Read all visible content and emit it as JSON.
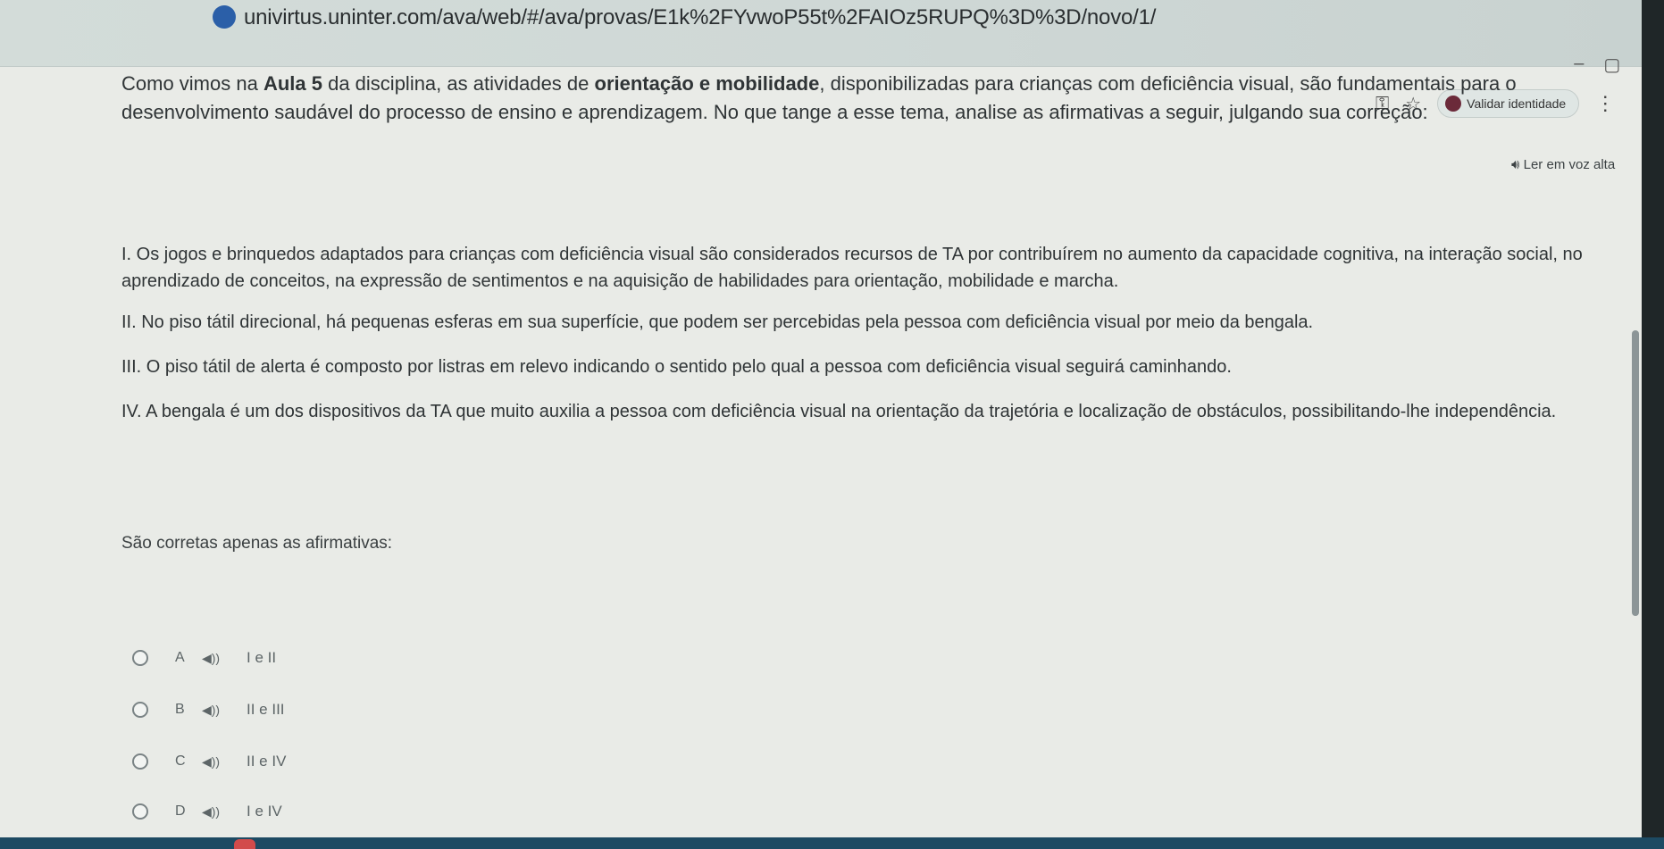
{
  "browser": {
    "url": "univirtus.uninter.com/ava/web/#/ava/provas/E1k%2FYvwoP55t%2FAIOz5RUPQ%3D%3D/novo/1/",
    "identity_button": "Validar identidade"
  },
  "page": {
    "read_aloud": "Ler em voz alta",
    "intro_part1": "Como vimos na ",
    "intro_bold1": "Aula 5",
    "intro_part2": " da disciplina, as atividades de ",
    "intro_bold2": "orientação e mobilidade",
    "intro_part3": ", disponibilizadas para crianças com deficiência visual, são fundamentais para o desenvolvimento saudável do processo de ensino e aprendizagem. No que tange a esse tema, analise as afirmativas a seguir, julgando sua correção:",
    "statements": [
      "I. Os jogos e brinquedos adaptados para crianças com deficiência visual são considerados recursos de TA por contribuírem no aumento da capacidade cognitiva, na interação social, no aprendizado de conceitos, na expressão de sentimentos e na aquisição de habilidades para orientação, mobilidade e marcha.",
      "II. No piso tátil direcional, há pequenas esferas em sua superfície, que podem ser percebidas pela pessoa com deficiência visual por meio da bengala.",
      "III. O piso tátil de alerta é composto por listras em relevo indicando o sentido pelo qual a pessoa com deficiência visual seguirá caminhando.",
      "IV. A bengala é um dos dispositivos da TA que muito auxilia a pessoa com deficiência visual na orientação da trajetória e localização de obstáculos, possibilitando-lhe independência."
    ],
    "prompt": "São corretas apenas as afirmativas:",
    "options": [
      {
        "letter": "A",
        "text": "I e II"
      },
      {
        "letter": "B",
        "text": "II e III"
      },
      {
        "letter": "C",
        "text": "II e IV"
      },
      {
        "letter": "D",
        "text": "I e IV"
      }
    ]
  },
  "icons": {
    "favicon": "uninter-logo-icon",
    "key": "key-icon",
    "star": "bookmark-star-icon",
    "speaker": "speaker-icon",
    "menu": "kebab-menu-icon"
  }
}
